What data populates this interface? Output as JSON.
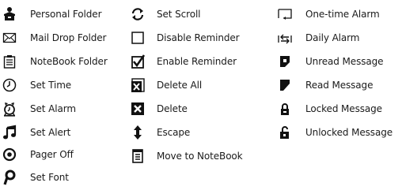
{
  "legend": {
    "column1": [
      {
        "label": "Personal Folder",
        "icon": "personal-folder-icon"
      },
      {
        "label": "Mail Drop Folder",
        "icon": "mail-drop-folder-icon"
      },
      {
        "label": "NoteBook Folder",
        "icon": "notebook-folder-icon"
      },
      {
        "label": "Set Time",
        "icon": "clock-icon"
      },
      {
        "label": "Set Alarm",
        "icon": "alarm-clock-icon"
      },
      {
        "label": "Set Alert",
        "icon": "music-note-icon"
      },
      {
        "label": "Pager Off",
        "icon": "pager-off-icon"
      },
      {
        "label": "Set Font",
        "icon": "font-icon"
      }
    ],
    "column2": [
      {
        "label": "Set Scroll",
        "icon": "scroll-icon"
      },
      {
        "label": "Disable Reminder",
        "icon": "empty-checkbox-icon"
      },
      {
        "label": "Enable Reminder",
        "icon": "checked-checkbox-icon"
      },
      {
        "label": "Delete All",
        "icon": "delete-all-icon"
      },
      {
        "label": "Delete",
        "icon": "delete-icon"
      },
      {
        "label": "Escape",
        "icon": "up-down-arrow-icon"
      },
      {
        "label": "Move to NoteBook",
        "icon": "notebook-page-icon"
      }
    ],
    "column3": [
      {
        "label": "One-time Alarm",
        "icon": "one-time-alarm-icon"
      },
      {
        "label": "Daily Alarm",
        "icon": "daily-alarm-icon"
      },
      {
        "label": "Unread Message",
        "icon": "unread-message-icon"
      },
      {
        "label": "Read Message",
        "icon": "read-message-icon"
      },
      {
        "label": "Locked Message",
        "icon": "locked-message-icon"
      },
      {
        "label": "Unlocked Message",
        "icon": "unlocked-message-icon"
      }
    ]
  }
}
